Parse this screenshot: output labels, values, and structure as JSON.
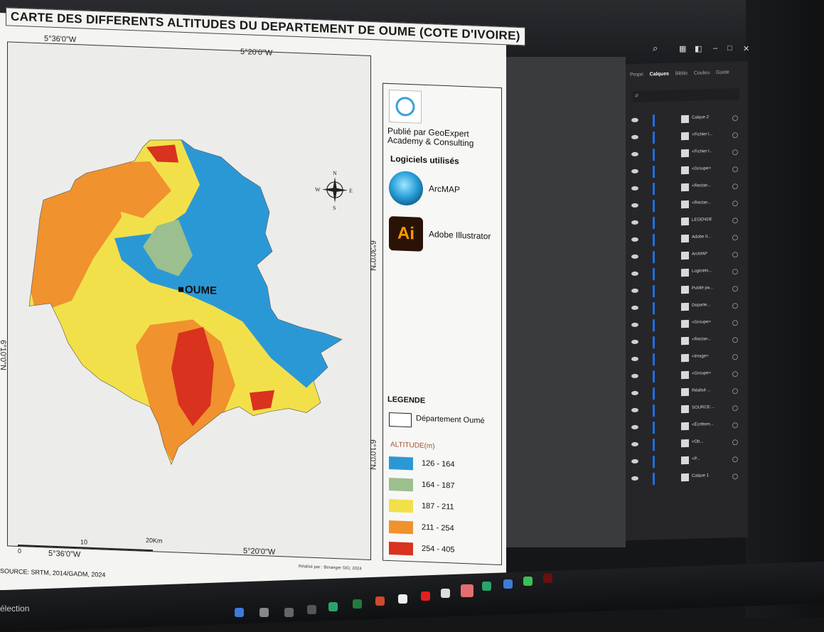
{
  "map": {
    "title": "CARTE DES DIFFERENTS ALTITUDES DU DEPARTEMENT DE OUME (COTE D'IVOIRE)",
    "coords": {
      "top_left": "5°36'0\"W",
      "top_center": "5°20'0\"W",
      "right_upper": "6°30'0\"N",
      "right_lower": "6°10'0\"N",
      "left_mid": "6°10'0\"N",
      "bottom_left": "5°36'0\"W",
      "bottom_center": "5°20'0\"W"
    },
    "city": "OUME",
    "scale": {
      "zero": "0",
      "ten": "10",
      "twenty": "20Km"
    },
    "source": "SOURCE: SRTM, 2014/GADM, 2024",
    "author": "Réalisé par : Beranger SIO, 2024",
    "colors": {
      "c126": "#2b98d6",
      "c164": "#9bbf8e",
      "c187": "#f2e04a",
      "c211": "#f0922e",
      "c254": "#d9321e"
    }
  },
  "panel": {
    "published_by": "Publié par GeoExpert Academy & Consulting",
    "software_title": "Logiciels utilisés",
    "software": [
      {
        "name": "ArcMAP",
        "icon": "arcmap-icon"
      },
      {
        "name": "Adobe Illustrator",
        "icon": "illustrator-icon",
        "glyph": "Ai"
      }
    ],
    "legend_title": "LEGENDE",
    "dept_label": "Département Oumé",
    "altitude_title": "ALTITUDE(m)",
    "classes": [
      {
        "range": "126 - 164",
        "color": "#2b98d6"
      },
      {
        "range": "164 - 187",
        "color": "#9bbf8e"
      },
      {
        "range": "187 - 211",
        "color": "#f2e04a"
      },
      {
        "range": "211 - 254",
        "color": "#f0922e"
      },
      {
        "range": "254 - 405",
        "color": "#d9321e"
      }
    ]
  },
  "layers_panel": {
    "tabs": [
      "Propri",
      "Calques",
      "Biblio",
      "Couleu",
      "Guide"
    ],
    "active_tab": "Calques",
    "rows": [
      "Calque 2",
      "<Fichier l...",
      "<Fichier l...",
      "<Groupe>",
      "<Rectan...",
      "<Rectan...",
      "LEGENDE",
      "Adobe Il...",
      "ArcMAP",
      "Logiciels...",
      "Publié pa...",
      "Departe...",
      "<Groupe>",
      "<Rectan...",
      "<Image>",
      "<Groupe>",
      "Réalisé ...",
      "SOURCE:...",
      "<Écrêtem...",
      "<Ob...",
      "<P...",
      "Calque 1"
    ]
  },
  "taskbar": {
    "selection_text": "élection"
  }
}
